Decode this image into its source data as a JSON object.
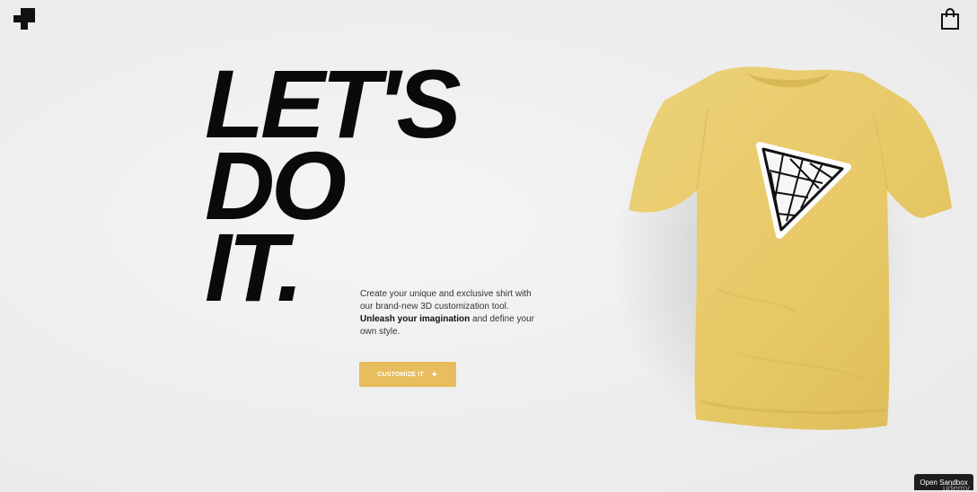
{
  "header": {
    "logo_icon": "pixel-logo-icon",
    "cart_icon": "shopping-bag-icon"
  },
  "hero": {
    "headline_line1": "LET'S",
    "headline_line2": "DO",
    "headline_line3": "IT.",
    "description_part1": "Create your unique and exclusive shirt with our brand-new 3D customization tool.",
    "description_bold": "Unleash your imagination",
    "description_part2": "and define your own style.",
    "cta_label": "CUSTOMIZE IT",
    "cta_icon": "magic-wand-icon"
  },
  "product": {
    "shirt_color": "#e8cc6e",
    "decal_icon": "triangle-grid-logo-icon"
  },
  "footer": {
    "sandbox_label": "Open Sandbox",
    "watermark": "udemy"
  },
  "colors": {
    "accent": "#e7bd5d",
    "text": "#0a0a0a",
    "background": "#efefef"
  }
}
